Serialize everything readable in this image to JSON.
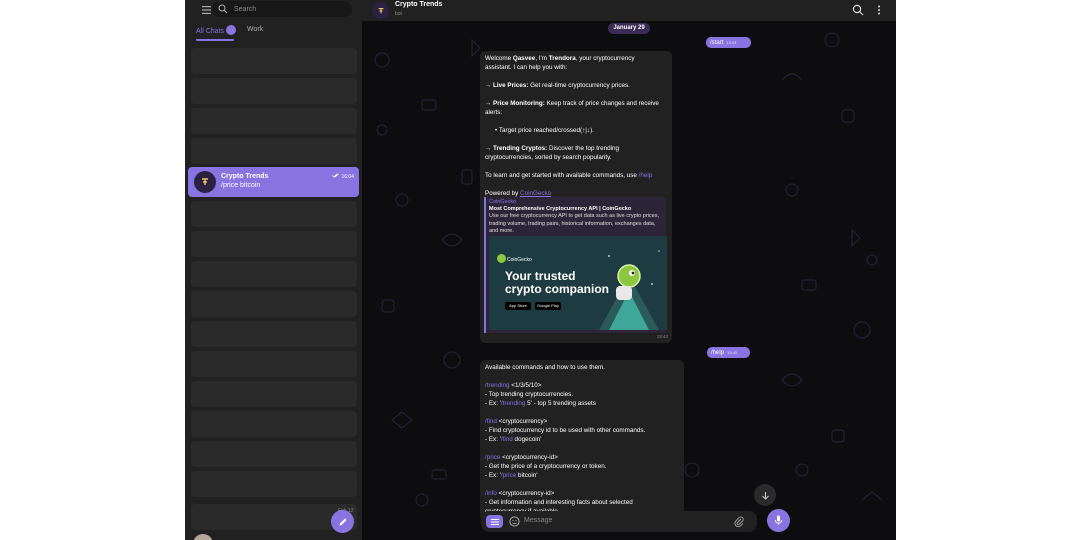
{
  "sidebar": {
    "search_placeholder": "Search",
    "folders": [
      {
        "label": "All Chats",
        "active": true
      },
      {
        "label": "Work",
        "active": false
      }
    ],
    "active_chat": {
      "name": "Crypto Trends",
      "preview": "/price bitcoin",
      "time": "16:04"
    },
    "faint_date": "Feb 12",
    "icons": [
      "menu-icon",
      "search-icon",
      "pencil-icon",
      "double-check-icon"
    ]
  },
  "chat": {
    "title": "Crypto Trends",
    "subtitle": "bot",
    "date_label": "January 29",
    "outgoing": [
      {
        "text": "/start",
        "time": "13:43"
      },
      {
        "text": "/help",
        "time": "13:43"
      }
    ],
    "welcome": {
      "intro_a": "Welcome ",
      "user": "Qasvee",
      "intro_b": ", I'm ",
      "bot": "Trendora",
      "intro_c": ", your cryptocurrency",
      "intro_line2": "assistant. I can help you with:",
      "f1_title": "→ Live Prices:",
      "f1_text": " Get real-time cryptocurrency prices.",
      "f2_title": "→ Price Monitoring:",
      "f2_text": " Keep track of price changes and receive",
      "f2_line2": "alerts:",
      "f2_bullet": "• Target price reached/crossed(↑|↓).",
      "f3_title": "→ Trending Cryptos:",
      "f3_text": " Discover the top trending",
      "f3_line2": "cryptocurrencies, sorted by search popularity.",
      "outro": "To learn and get started with available commands, use ",
      "outro_link": "/help",
      "powered": "Powered by ",
      "powered_link": "CoinGecko",
      "time": "13:43"
    },
    "link_preview": {
      "site": "CoinGecko",
      "title": "Most Comprehensive Cryptocurrency API | CoinGecko",
      "description": "Use our free cryptocurrency API to get data such as live crypto prices, trading volume, trading pairs, historical information, exchanges data, and more.",
      "image_brand": "CoinGecko",
      "image_headline_1": "Your trusted",
      "image_headline_2": "crypto companion",
      "badge_1": "App Store",
      "badge_2": "Google Play"
    },
    "help": {
      "intro": "Available commands and how to use them.",
      "trending_cmd": "/trending",
      "trending_args": " <1/3/5/10>",
      "trending_d1": "- Top trending cryptocurrencies.",
      "trending_ex_a": "- Ex: '",
      "trending_ex_cmd": "/trending",
      "trending_ex_b": " 5' - top 5 trending assets",
      "find_cmd": "/find",
      "find_args": " <cryptocurrency>",
      "find_d1": "- Find cryptocurrency id to be used with other commands.",
      "find_ex_a": "- Ex: '",
      "find_ex_cmd": "/find",
      "find_ex_b": " dogecoin'",
      "price_cmd": "/price",
      "price_args": " <cryptocurrency-id>",
      "price_d1": "- Get the price of a cryptocurrency or token.",
      "price_ex_a": "- Ex: '",
      "price_ex_cmd": "/price",
      "price_ex_b": " bitcoin'",
      "info_cmd": "/info",
      "info_args": " <cryptocurrency-id>",
      "info_d1": "- Get information and interesting facts about selected",
      "info_d2": "cryptocurrency if available"
    },
    "composer_placeholder": "Message"
  },
  "colors": {
    "accent": "#8774e1",
    "sidebar_bg": "#212121",
    "chat_bg": "#0d0d0f",
    "bubble_in": "#212121"
  }
}
